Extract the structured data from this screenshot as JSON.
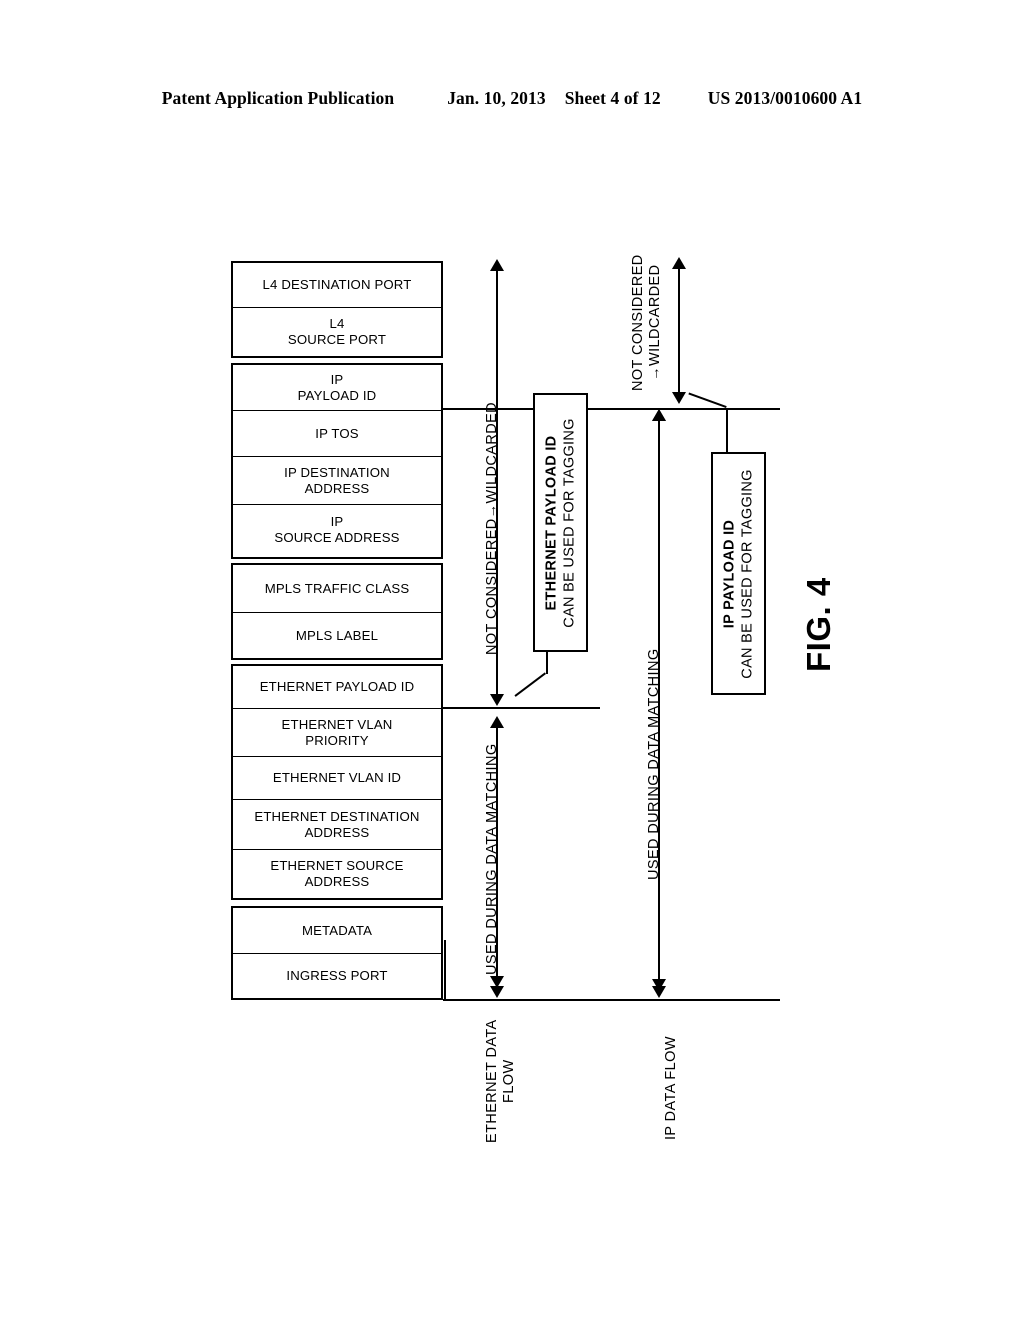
{
  "header": {
    "publication": "Patent Application Publication",
    "date": "Jan. 10, 2013",
    "sheet": "Sheet 4 of 12",
    "number": "US 2013/0010600 A1"
  },
  "figure": {
    "caption": "FIG. 4",
    "field_groups": [
      {
        "name": "l4-group",
        "fields": [
          {
            "label": "L4 DESTINATION PORT",
            "lines": [
              "L4 DESTINATION PORT"
            ]
          },
          {
            "label": "L4 SOURCE PORT",
            "lines": [
              "L4",
              "SOURCE PORT"
            ]
          }
        ]
      },
      {
        "name": "ip-group",
        "fields": [
          {
            "label": "IP PAYLOAD ID",
            "lines": [
              "IP",
              "PAYLOAD ID"
            ]
          },
          {
            "label": "IP TOS",
            "lines": [
              "IP TOS"
            ]
          },
          {
            "label": "IP DESTINATION ADDRESS",
            "lines": [
              "IP DESTINATION",
              "ADDRESS"
            ]
          },
          {
            "label": "IP SOURCE ADDRESS",
            "lines": [
              "IP",
              "SOURCE ADDRESS"
            ]
          }
        ]
      },
      {
        "name": "mpls-group",
        "fields": [
          {
            "label": "MPLS TRAFFIC CLASS",
            "lines": [
              "MPLS TRAFFIC CLASS"
            ]
          },
          {
            "label": "MPLS LABEL",
            "lines": [
              "MPLS LABEL"
            ]
          }
        ]
      },
      {
        "name": "ethernet-group",
        "fields": [
          {
            "label": "ETHERNET PAYLOAD ID",
            "lines": [
              "ETHERNET PAYLOAD ID"
            ]
          },
          {
            "label": "ETHERNET VLAN PRIORITY",
            "lines": [
              "ETHERNET VLAN",
              "PRIORITY"
            ]
          },
          {
            "label": "ETHERNET VLAN ID",
            "lines": [
              "ETHERNET VLAN ID"
            ]
          },
          {
            "label": "ETHERNET DESTINATION ADDRESS",
            "lines": [
              "ETHERNET DESTINATION",
              "ADDRESS"
            ]
          },
          {
            "label": "ETHERNET SOURCE ADDRESS",
            "lines": [
              "ETHERNET SOURCE",
              "ADDRESS"
            ]
          }
        ]
      },
      {
        "name": "metadata-group",
        "fields": [
          {
            "label": "METADATA",
            "lines": [
              "METADATA"
            ]
          },
          {
            "label": "INGRESS PORT",
            "lines": [
              "INGRESS PORT"
            ]
          }
        ]
      }
    ],
    "annotations": {
      "eth_not_considered": "NOT CONSIDERED→WILDCARDED",
      "eth_used_matching": "USED DURING DATA MATCHING",
      "ip_not_considered_line1": "NOT CONSIDERED",
      "ip_not_considered_line2": "→WILDCARDED",
      "ip_used_matching": "USED DURING DATA MATCHING",
      "eth_flow_line1": "ETHERNET DATA",
      "eth_flow_line2": "FLOW",
      "ip_flow": "IP DATA FLOW"
    },
    "callouts": [
      {
        "name": "ethernet-payload-callout",
        "title": "ETHERNET PAYLOAD ID",
        "subtitle": "CAN BE USED FOR TAGGING"
      },
      {
        "name": "ip-payload-callout",
        "title": "IP PAYLOAD ID",
        "subtitle": "CAN BE USED FOR TAGGING"
      }
    ]
  },
  "colors": {
    "ink": "#000000",
    "paper": "#ffffff"
  }
}
